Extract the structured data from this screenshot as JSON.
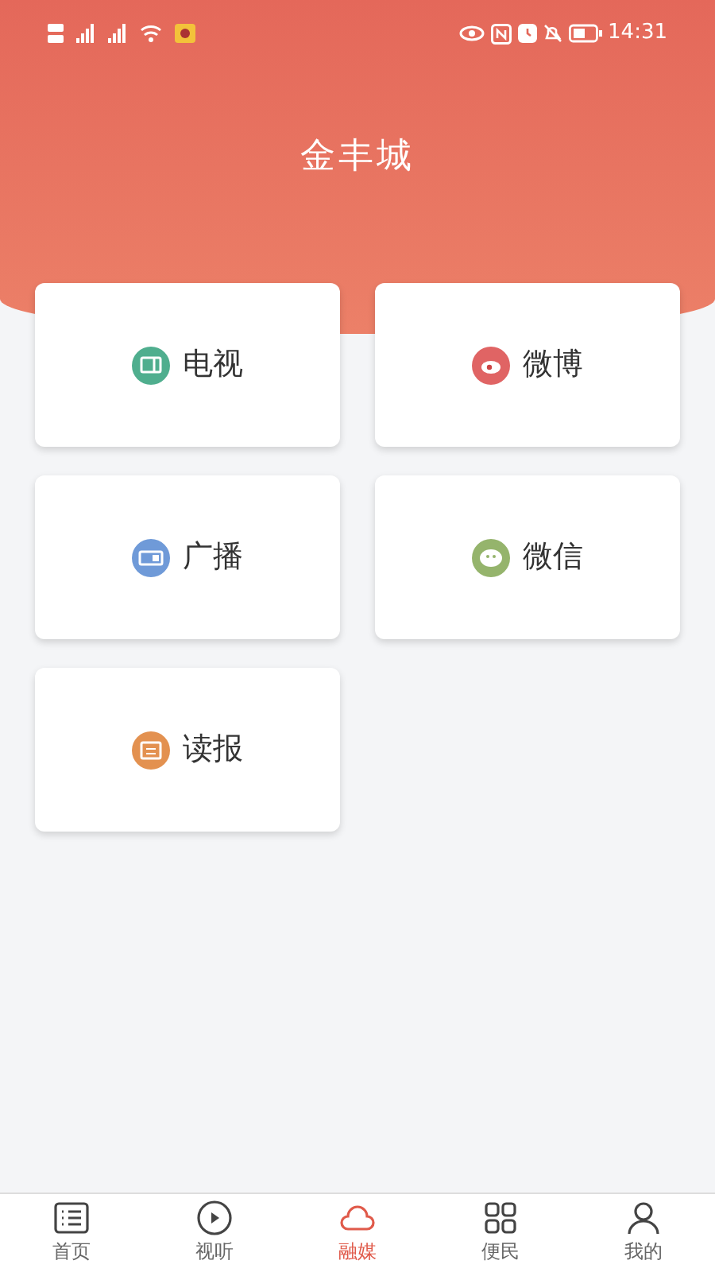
{
  "status_bar": {
    "time": "14:31"
  },
  "header": {
    "title": "金丰城"
  },
  "tiles": [
    {
      "label": "电视",
      "kind": "tv",
      "color": "#4fae8e"
    },
    {
      "label": "微博",
      "kind": "weibo",
      "color": "#e06464"
    },
    {
      "label": "广播",
      "kind": "radio",
      "color": "#6f9ad8"
    },
    {
      "label": "微信",
      "kind": "wechat",
      "color": "#95b46c"
    },
    {
      "label": "读报",
      "kind": "paper",
      "color": "#e39150"
    }
  ],
  "bottom_nav": [
    {
      "label": "首页",
      "kind": "list",
      "selected": false
    },
    {
      "label": "视听",
      "kind": "play",
      "selected": false
    },
    {
      "label": "融媒",
      "kind": "cloud",
      "selected": true
    },
    {
      "label": "便民",
      "kind": "grid",
      "selected": false
    },
    {
      "label": "我的",
      "kind": "user",
      "selected": false
    }
  ]
}
